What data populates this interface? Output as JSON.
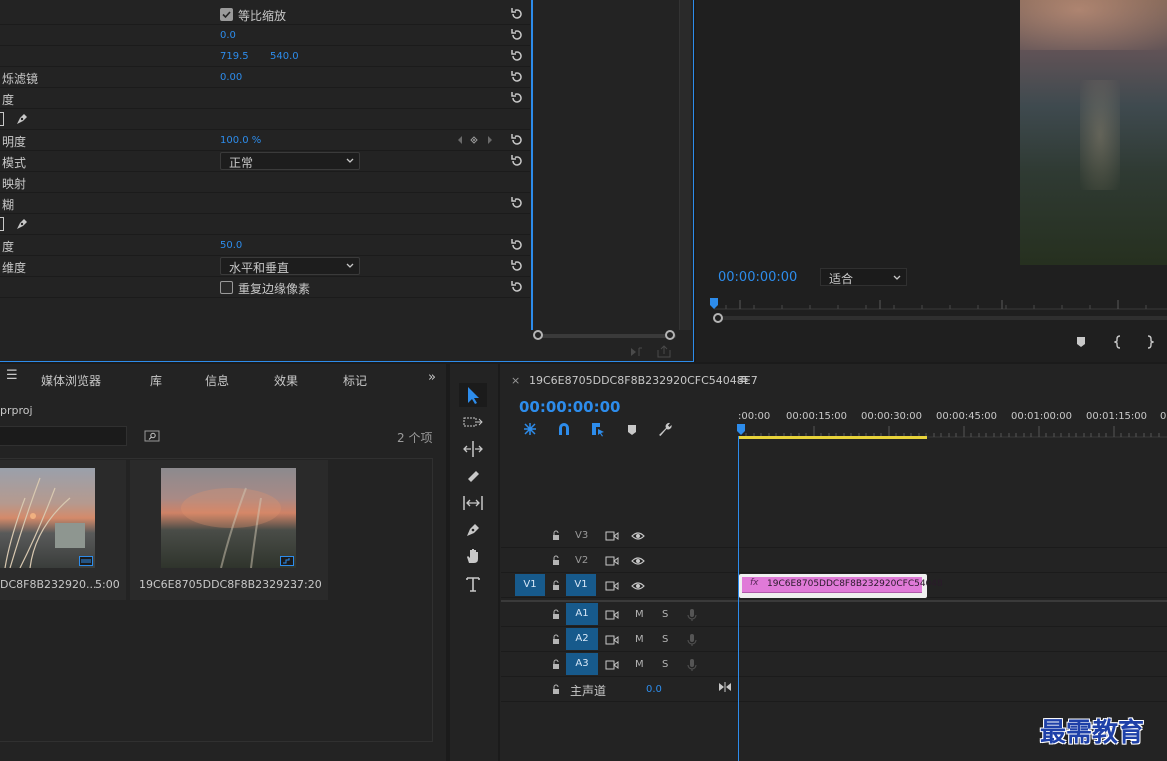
{
  "effect_controls": {
    "rows": [
      {
        "label": "",
        "check_label": "等比缩放",
        "checked": true
      },
      {
        "label": "",
        "value": "0.0"
      },
      {
        "label": "",
        "value_a": "719.5",
        "value_b": "540.0"
      },
      {
        "label": "烁滤镜",
        "value": "0.00"
      },
      {
        "label": "度"
      },
      {
        "label": ""
      },
      {
        "label": "明度",
        "value": "100.0 %"
      },
      {
        "label": "模式",
        "dropdown": "正常"
      },
      {
        "label": "映射"
      },
      {
        "label": "糊"
      },
      {
        "label": ""
      },
      {
        "label": "度",
        "value": "50.0"
      },
      {
        "label": "维度",
        "dropdown": "水平和垂直"
      },
      {
        "label": "",
        "check_label": "重复边缘像素",
        "checked": false
      }
    ]
  },
  "program_monitor": {
    "timecode": "00:00:00:00",
    "fit_label": "适合"
  },
  "project_panel": {
    "tabs": [
      "媒体浏览器",
      "库",
      "信息",
      "效果",
      "标记"
    ],
    "project_name": "prproj",
    "item_count": "2 个项",
    "items": [
      {
        "name": "DC8F8B232920...",
        "duration": "5:00"
      },
      {
        "name": "19C6E8705DDC8F8B23292...",
        "duration": "37:20"
      }
    ]
  },
  "timeline": {
    "sequence_name": "19C6E8705DDC8F8B232920CFC54048E7",
    "timecode": "00:00:00:00",
    "ruler_labels": [
      ":00:00",
      "00:00:15:00",
      "00:00:30:00",
      "00:00:45:00",
      "00:01:00:00",
      "00:01:15:00",
      "0"
    ],
    "video_tracks": [
      {
        "name": "V3",
        "source": ""
      },
      {
        "name": "V2",
        "source": ""
      },
      {
        "name": "V1",
        "source": "V1"
      }
    ],
    "audio_tracks": [
      {
        "name": "A1",
        "m": "M",
        "s": "S"
      },
      {
        "name": "A2",
        "m": "M",
        "s": "S"
      },
      {
        "name": "A3",
        "m": "M",
        "s": "S"
      }
    ],
    "master": {
      "label": "主声道",
      "value": "0.0"
    },
    "clip": {
      "fx": "fx",
      "label": "19C6E8705DDC8F8B232920CFC54048"
    }
  },
  "watermark": "最需教育",
  "colors": {
    "accent": "#2d8ceb",
    "clip": "#e07ad8",
    "work_area": "#e8d33a",
    "target_track": "#175a8c"
  }
}
